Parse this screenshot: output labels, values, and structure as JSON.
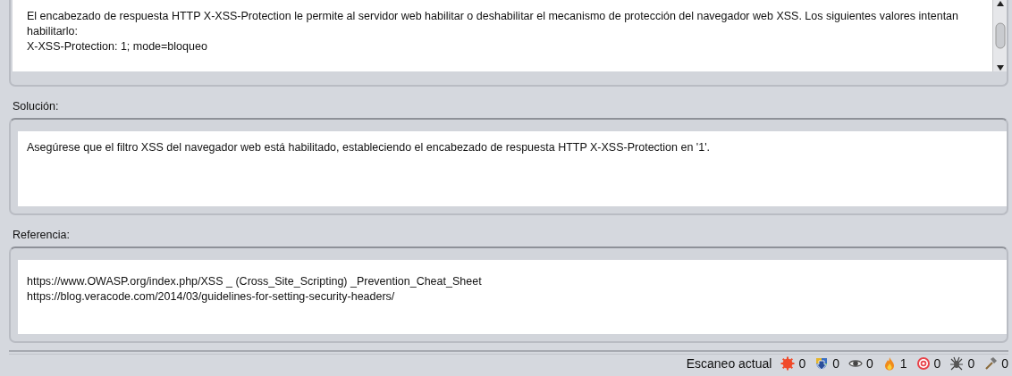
{
  "description": {
    "lines": [
      "El encabezado de respuesta HTTP X-XSS-Protection le permite al servidor web habilitar o deshabilitar el mecanismo de protección del navegador web XSS. Los siguientes valores intentan habilitarlo:",
      "X-XSS-Protection: 1; mode=bloqueo"
    ]
  },
  "solution": {
    "label": "Solución:",
    "lines": [
      "Asegúrese que el filtro XSS del navegador web está habilitado, estableciendo el encabezado de respuesta HTTP X-XSS-Protection en '1'."
    ]
  },
  "reference": {
    "label": "Referencia:",
    "lines": [
      "https://www.OWASP.org/index.php/XSS _ (Cross_Site_Scripting) _Prevention_Cheat_Sheet",
      "https://blog.veracode.com/2014/03/guidelines-for-setting-security-headers/"
    ]
  },
  "status_bar": {
    "label": "Escaneo actual",
    "counters": [
      {
        "kind": "burst",
        "count": "0"
      },
      {
        "kind": "download",
        "count": "0"
      },
      {
        "kind": "eye",
        "count": "0"
      },
      {
        "kind": "flame",
        "count": "1"
      },
      {
        "kind": "target",
        "count": "0"
      },
      {
        "kind": "spider",
        "count": "0"
      },
      {
        "kind": "hammer",
        "count": "0"
      }
    ]
  }
}
